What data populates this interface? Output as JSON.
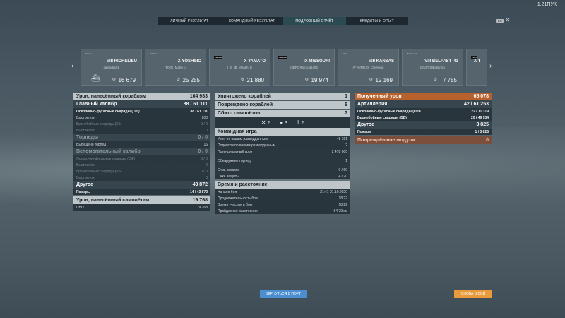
{
  "top_counter": "1.21ПУК",
  "tabs": [
    {
      "label": "ЛИЧНЫЙ РЕЗУЛЬТАТ",
      "active": false
    },
    {
      "label": "КОМАНДНЫЙ РЕЗУЛЬТАТ",
      "active": false
    },
    {
      "label": "ПОДРОБНЫЙ ОТЧЁТ",
      "active": true
    },
    {
      "label": "КРЕДИТЫ И ОПЫТ",
      "active": false
    }
  ],
  "lang_badge": "EN",
  "close_symbol": "✕",
  "nav": {
    "left": "‹",
    "right": "›"
  },
  "cards": [
    {
      "tier_name": "VIII RICHELIEU",
      "player": "calendula1",
      "value": "16 679",
      "nation": "France",
      "ribbon": ""
    },
    {
      "tier_name": "X YOSHINO",
      "player": "[TOG]_Mobe_u",
      "value": "25 255",
      "nation": "Yoshino",
      "ribbon": ""
    },
    {
      "tier_name": "X YAMATO",
      "player": "[_S_]B_Mirash_E",
      "value": "21 880",
      "nation": "",
      "ribbon": "Yamato"
    },
    {
      "tier_name": "IX MISSOURI",
      "player": "[3EPO]Recruit1406",
      "value": "19 974",
      "nation": "",
      "ribbon": "Missouri"
    },
    {
      "tier_name": "VIII KANSAS",
      "player": "[V_KING]O_CreeKing",
      "value": "12 169",
      "nation": "USA",
      "ribbon": ""
    },
    {
      "tier_name": "VIII BELFAST '43",
      "player": "[KUSTS]Bullitmm",
      "value": "7 755",
      "nation": "Belfast '43",
      "ribbon": ""
    },
    {
      "tier_name": "X T",
      "player": "",
      "value": "",
      "nation": "",
      "ribbon": "Petro"
    }
  ],
  "left": {
    "dealt_header": {
      "label": "Урон, нанесённый кораблям",
      "value": "104 983"
    },
    "main_cal": {
      "label": "Главный калибр",
      "hits": "88",
      "total": "61 111"
    },
    "he_shells": {
      "label": "Осколочно-фугасные снаряды (ОФ)",
      "hits": "88",
      "total": "61 111"
    },
    "shots": {
      "label": "Выстрелов",
      "value": "200"
    },
    "ap_shells": {
      "label": "Бронебойные снаряды (ББ)",
      "value": "0 / 0"
    },
    "shots2": {
      "label": "Выстрелов",
      "value": "0"
    },
    "torps": {
      "label": "Торпеды",
      "value": "0 / 0"
    },
    "torps_fired": {
      "label": "Выпущено торпед",
      "value": "16"
    },
    "secondary": {
      "label": "Вспомогательный калибр",
      "value": "0 / 0"
    },
    "sec_he": {
      "label": "Осколочно-фугасные снаряды (ОФ)",
      "value": "0 / 0"
    },
    "sec_shots": {
      "label": "Выстрелов",
      "value": "0"
    },
    "sec_ap": {
      "label": "Бронебойные снаряды (ББ)",
      "value": "0 / 0"
    },
    "sec_shots2": {
      "label": "Выстрелов",
      "value": "0"
    },
    "other": {
      "label": "Другое",
      "value": "43 872"
    },
    "fires": {
      "label": "Пожары",
      "hits": "14",
      "total": "43 872"
    },
    "planes_header": {
      "label": "Урон, нанесённый самолётам",
      "value": "19 768"
    },
    "aa": {
      "label": "ПВО",
      "value": "19 768"
    }
  },
  "middle": {
    "destroyed": {
      "label": "Уничтожено кораблей",
      "value": "1"
    },
    "damaged": {
      "label": "Повреждено кораблей",
      "value": "6"
    },
    "planes": {
      "label": "Сбито самолётов",
      "value": "7"
    },
    "icons": [
      {
        "icon": "crossed-guns-icon",
        "glyph": "✕",
        "count": "2"
      },
      {
        "icon": "bomb-icon",
        "glyph": "●",
        "count": "3"
      },
      {
        "icon": "fire-icon",
        "glyph": "‖",
        "count": "2"
      }
    ],
    "team_header": "Командная игра",
    "team_rows": [
      {
        "label": "Урон по вашим разведданным",
        "value": "48 161"
      },
      {
        "label": "Подожгли по вашим разведданным",
        "value": "2"
      },
      {
        "label": "Потенциальный урон",
        "value": "2 478 000"
      },
      {
        "label": "Обнаружено торпед",
        "value": "1"
      },
      {
        "label": "Очки захвата",
        "value": "0 / 60"
      },
      {
        "label": "Очки защиты",
        "value": "4 / 20"
      }
    ],
    "time_header": "Время и расстояние",
    "time_rows": [
      {
        "label": "Начало боя",
        "value": "21:41  21.10.2020"
      },
      {
        "label": "Продолжительность боя",
        "value": "18:22"
      },
      {
        "label": "Время участия в бою",
        "value": "18:22"
      },
      {
        "label": "Пройденное расстояние",
        "value": "64.79 км"
      }
    ]
  },
  "right": {
    "received_header": {
      "label": "Полученный урон",
      "value": "65 078"
    },
    "artillery": {
      "label": "Артиллерия",
      "hits": "42",
      "total": "61 253"
    },
    "he": {
      "label": "Осколочно-фугасные снаряды (ОФ)",
      "hits": "22",
      "total": "11 319"
    },
    "ap": {
      "label": "Бронебойные снаряды (ББ)",
      "hits": "20",
      "total": "49 934"
    },
    "other": {
      "label": "Другое",
      "value": "3 825"
    },
    "fires": {
      "label": "Пожары",
      "hits": "1",
      "total": "3 825"
    },
    "modules": {
      "label": "Повреждённые модули",
      "value": "0"
    }
  },
  "buttons": {
    "port": "ВЕРНУТЬСЯ В ПОРТ",
    "battle": "СНОВА В БОЙ"
  }
}
